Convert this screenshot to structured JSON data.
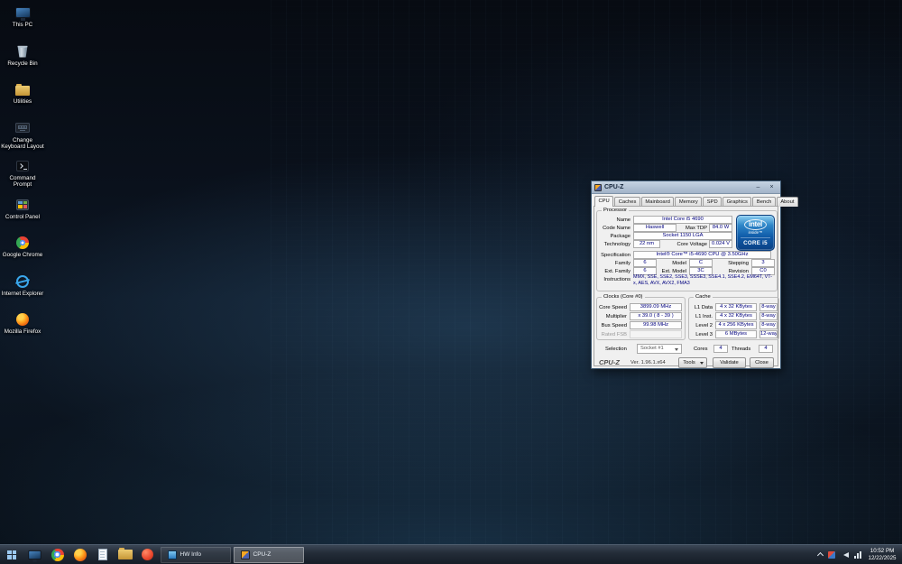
{
  "desktop": {
    "icons": [
      {
        "label": "This PC"
      },
      {
        "label": "Recycle Bin"
      },
      {
        "label": "Utilities"
      },
      {
        "label": "Change Keyboard Layout"
      },
      {
        "label": "Command Prompt"
      },
      {
        "label": "Control Panel"
      },
      {
        "label": "Google Chrome"
      },
      {
        "label": "Internet Explorer"
      },
      {
        "label": "Mozilla Firefox"
      }
    ]
  },
  "cpuz": {
    "title": "CPU-Z",
    "window_controls": {
      "minimize": "–",
      "close": "×"
    },
    "tabs": [
      "CPU",
      "Caches",
      "Mainboard",
      "Memory",
      "SPD",
      "Graphics",
      "Bench",
      "About"
    ],
    "processor": {
      "group_label": "Processor",
      "name_label": "Name",
      "name": "Intel Core i5 4690",
      "code_name_label": "Code Name",
      "code_name": "Haswell",
      "max_tdp_label": "Max TDP",
      "max_tdp": "84.0 W",
      "package_label": "Package",
      "package": "Socket 1150 LGA",
      "technology_label": "Technology",
      "technology": "22 nm",
      "core_voltage_label": "Core Voltage",
      "core_voltage": "0.024 V",
      "specification_label": "Specification",
      "specification": "Intel® Core™ i5-4690 CPU @ 3.50GHz",
      "family_label": "Family",
      "family": "6",
      "model_label": "Model",
      "model": "C",
      "stepping_label": "Stepping",
      "stepping": "3",
      "ext_family_label": "Ext. Family",
      "ext_family": "6",
      "ext_model_label": "Ext. Model",
      "ext_model": "3C",
      "revision_label": "Revision",
      "revision": "C0",
      "instructions_label": "Instructions",
      "instructions": "MMX, SSE, SSE2, SSE3, SSSE3, SSE4.1, SSE4.2, EM64T, VT-x, AES, AVX, AVX2, FMA3",
      "badge": {
        "brand": "intel",
        "inside": "inside™",
        "core": "CORE i5"
      }
    },
    "clocks": {
      "group_label": "Clocks (Core #0)",
      "core_speed_label": "Core Speed",
      "core_speed": "3899.09 MHz",
      "multiplier_label": "Multiplier",
      "multiplier": "x 39.0 ( 8 - 39 )",
      "bus_speed_label": "Bus Speed",
      "bus_speed": "99.98 MHz",
      "rated_fsb_label": "Rated FSB",
      "rated_fsb": ""
    },
    "cache": {
      "group_label": "Cache",
      "rows": [
        {
          "label": "L1 Data",
          "size": "4 x 32 KBytes",
          "way": "8-way"
        },
        {
          "label": "L1 Inst.",
          "size": "4 x 32 KBytes",
          "way": "8-way"
        },
        {
          "label": "Level 2",
          "size": "4 x 256 KBytes",
          "way": "8-way"
        },
        {
          "label": "Level 3",
          "size": "6 MBytes",
          "way": "12-way"
        }
      ]
    },
    "footer": {
      "selection_label": "Selection",
      "selection_value": "Socket #1",
      "cores_label": "Cores",
      "cores": "4",
      "threads_label": "Threads",
      "threads": "4",
      "brand": "CPU-Z",
      "version": "Ver. 1.96.1.x64",
      "tools_label": "Tools",
      "validate_label": "Validate",
      "close_label": "Close"
    }
  },
  "taskbar": {
    "buttons": [
      {
        "label": "HW Info"
      },
      {
        "label": "CPU-Z"
      }
    ],
    "clock": {
      "time": "10:52 PM",
      "date": "12/22/2025"
    }
  }
}
